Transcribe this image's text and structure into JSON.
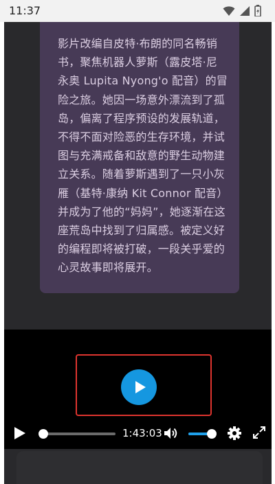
{
  "status_bar": {
    "time": "11:37",
    "icons": [
      "wifi-icon",
      "signal-icon",
      "battery-icon"
    ]
  },
  "description": {
    "text": "影片改编自皮特·布朗的同名畅销书，聚焦机器人萝斯（露皮塔·尼永奥 Lupita Nyong'o 配音）的冒险之旅。她因一场意外漂流到了孤岛，偏离了程序预设的发展轨道，不得不面对险恶的生存环境，并试图与充满戒备和敌意的野生动物建立关系。随着萝斯遇到了一只小灰雁（基特·康纳 Kit Connor 配音）并成为了他的“妈妈”，她逐渐在这座荒岛中找到了归属感。被定义好的编程即将被打破，一段关乎爱的心灵故事即将展开。"
  },
  "player": {
    "duration": "1:43:03",
    "progress": 0.03,
    "volume": 0.95,
    "accent_color": "#1597e0",
    "highlight_color": "#e0352f",
    "icons": [
      "play-icon",
      "volume-icon",
      "gear-icon",
      "fullscreen-icon"
    ]
  }
}
